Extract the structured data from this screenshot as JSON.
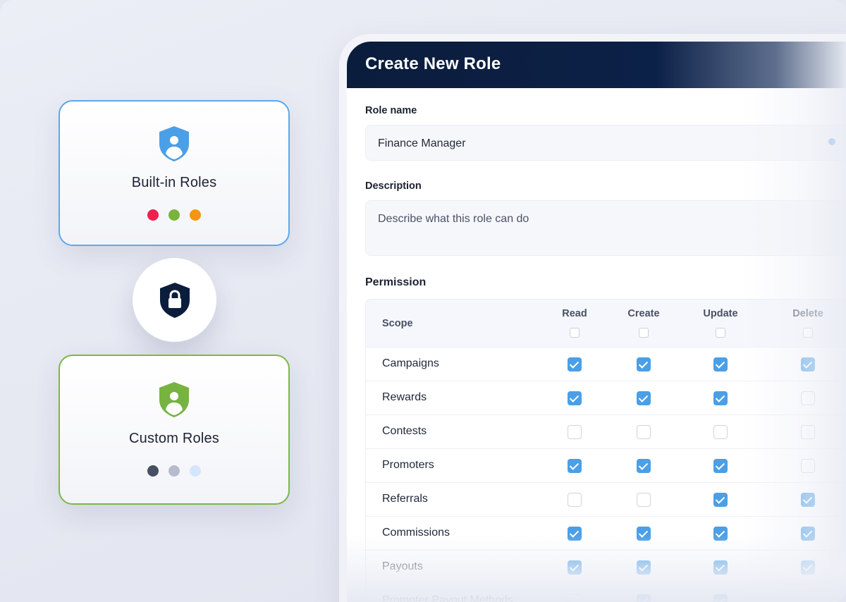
{
  "cards": {
    "builtin": {
      "title": "Built-in Roles",
      "icon": "user-shield-icon",
      "accent": "#5aa9ee",
      "dots": [
        "#ee1f4f",
        "#79b33b",
        "#f6950e"
      ]
    },
    "custom": {
      "title": "Custom Roles",
      "icon": "user-shield-icon",
      "accent": "#7bb846",
      "dots": [
        "#465064",
        "#b6bccb",
        "#d3e6fb"
      ]
    },
    "center_icon": "lock-shield-icon"
  },
  "form": {
    "title": "Create New Role",
    "role_name_label": "Role name",
    "role_name_value": "Finance Manager",
    "description_label": "Description",
    "description_placeholder": "Describe what this role can do",
    "permission_label": "Permission"
  },
  "permissions": {
    "scope_header": "Scope",
    "columns": [
      "Read",
      "Create",
      "Update",
      "Delete"
    ],
    "rows": [
      {
        "scope": "Campaigns",
        "values": [
          true,
          true,
          true,
          true
        ]
      },
      {
        "scope": "Rewards",
        "values": [
          true,
          true,
          true,
          false
        ]
      },
      {
        "scope": "Contests",
        "values": [
          false,
          false,
          false,
          false
        ]
      },
      {
        "scope": "Promoters",
        "values": [
          true,
          true,
          true,
          false
        ]
      },
      {
        "scope": "Referrals",
        "values": [
          false,
          false,
          true,
          true
        ]
      },
      {
        "scope": "Commissions",
        "values": [
          true,
          true,
          true,
          true
        ]
      },
      {
        "scope": "Payouts",
        "values": [
          true,
          true,
          true,
          true
        ]
      },
      {
        "scope": "Promoter Payout Methods",
        "values": [
          false,
          true,
          true,
          false
        ]
      }
    ]
  },
  "colors": {
    "header_dark": "#0b1d3c",
    "checkbox_on": "#4b9fe6"
  }
}
